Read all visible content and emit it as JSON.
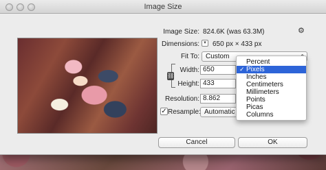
{
  "window": {
    "title": "Image Size"
  },
  "info": {
    "image_size_label": "Image Size:",
    "image_size_value": "824.6K (was 63.3M)",
    "dimensions_label": "Dimensions:",
    "dimensions_value": "650 px  ×  433 px",
    "disclosure_glyph": "▾"
  },
  "fit_to": {
    "label": "Fit To:",
    "value": "Custom"
  },
  "width": {
    "label": "Width:",
    "value": "650"
  },
  "height": {
    "label": "Height:",
    "value": "433"
  },
  "resolution": {
    "label": "Resolution:",
    "value": "8.862"
  },
  "resample": {
    "label": "Resample:",
    "checked": true,
    "check_glyph": "✓",
    "value": "Automatic"
  },
  "buttons": {
    "cancel": "Cancel",
    "ok": "OK"
  },
  "unit_menu": {
    "items": [
      {
        "label": "Percent",
        "selected": false
      },
      {
        "label": "Pixels",
        "selected": true
      },
      {
        "label": "Inches",
        "selected": false
      },
      {
        "label": "Centimeters",
        "selected": false
      },
      {
        "label": "Millimeters",
        "selected": false
      },
      {
        "label": "Points",
        "selected": false
      },
      {
        "label": "Picas",
        "selected": false
      },
      {
        "label": "Columns",
        "selected": false
      }
    ],
    "check_glyph": "✓"
  },
  "icons": {
    "gear": "⚙",
    "link": "⛓",
    "popup_arrows": "⇕"
  },
  "colors": {
    "menu_highlight": "#2d64d8",
    "dialog_bg": "#ececec"
  }
}
